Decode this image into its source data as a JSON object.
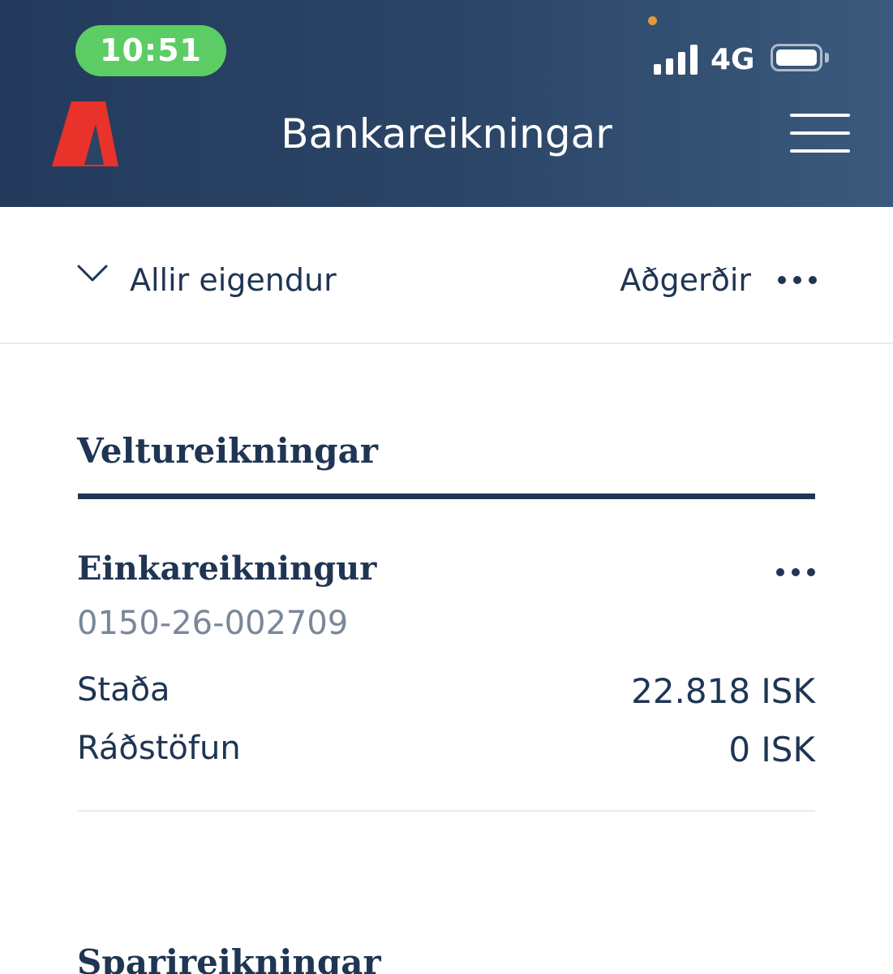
{
  "status_bar": {
    "time": "10:51",
    "network": "4G"
  },
  "header": {
    "title": "Bankareikningar"
  },
  "filter_bar": {
    "owner_filter_label": "Allir eigendur",
    "actions_label": "Aðgerðir"
  },
  "sections": [
    {
      "title": "Veltureikningar",
      "accounts": [
        {
          "name": "Einkareikningur",
          "number": "0150-26-002709",
          "rows": [
            {
              "label": "Staða",
              "value": "22.818 ISK"
            },
            {
              "label": "Ráðstöfun",
              "value": "0 ISK"
            }
          ]
        }
      ]
    },
    {
      "title": "Sparireikningar",
      "accounts": []
    }
  ],
  "colors": {
    "header_gradient_start": "#233a5c",
    "header_gradient_end": "#3a5a7d",
    "brand_red": "#e8322a",
    "text_primary": "#1f3553",
    "text_muted": "#7a879a",
    "time_pill_green": "#5ccd65"
  },
  "icons": {
    "logo": "landsbankinn-logo",
    "menu": "hamburger-menu-icon",
    "chevron": "chevron-down-icon",
    "more": "more-horizontal-icon"
  }
}
